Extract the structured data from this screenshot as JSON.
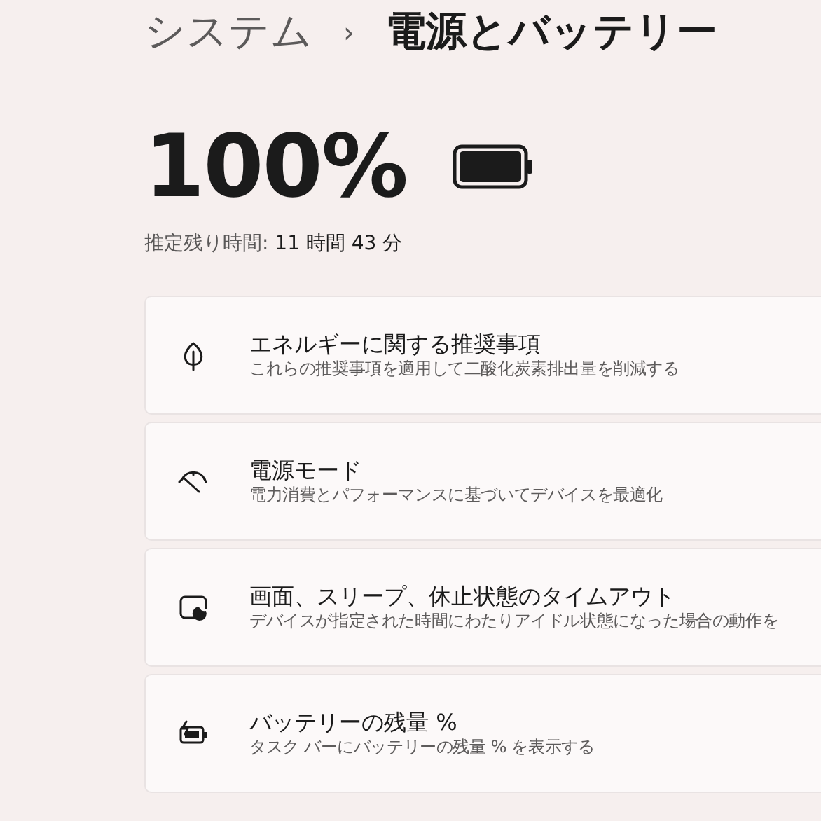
{
  "breadcrumb": {
    "parent": "システム",
    "separator": "›",
    "current": "電源とバッテリー"
  },
  "battery": {
    "percent": "100%",
    "estimate_label": "推定残り時間:",
    "estimate_value": "11 時間 43 分"
  },
  "settings": [
    {
      "kind": "leaf",
      "title": "エネルギーに関する推奨事項",
      "subtitle": "これらの推奨事項を適用して二酸化炭素排出量を削減する"
    },
    {
      "kind": "gauge",
      "title": "電源モード",
      "subtitle": "電力消費とパフォーマンスに基づいてデバイスを最適化"
    },
    {
      "kind": "sleep",
      "title": "画面、スリープ、休止状態のタイムアウト",
      "subtitle": "デバイスが指定された時間にわたりアイドル状態になった場合の動作を"
    },
    {
      "kind": "battery",
      "title": "バッテリーの残量 %",
      "subtitle": "タスク バーにバッテリーの残量 % を表示する"
    }
  ]
}
